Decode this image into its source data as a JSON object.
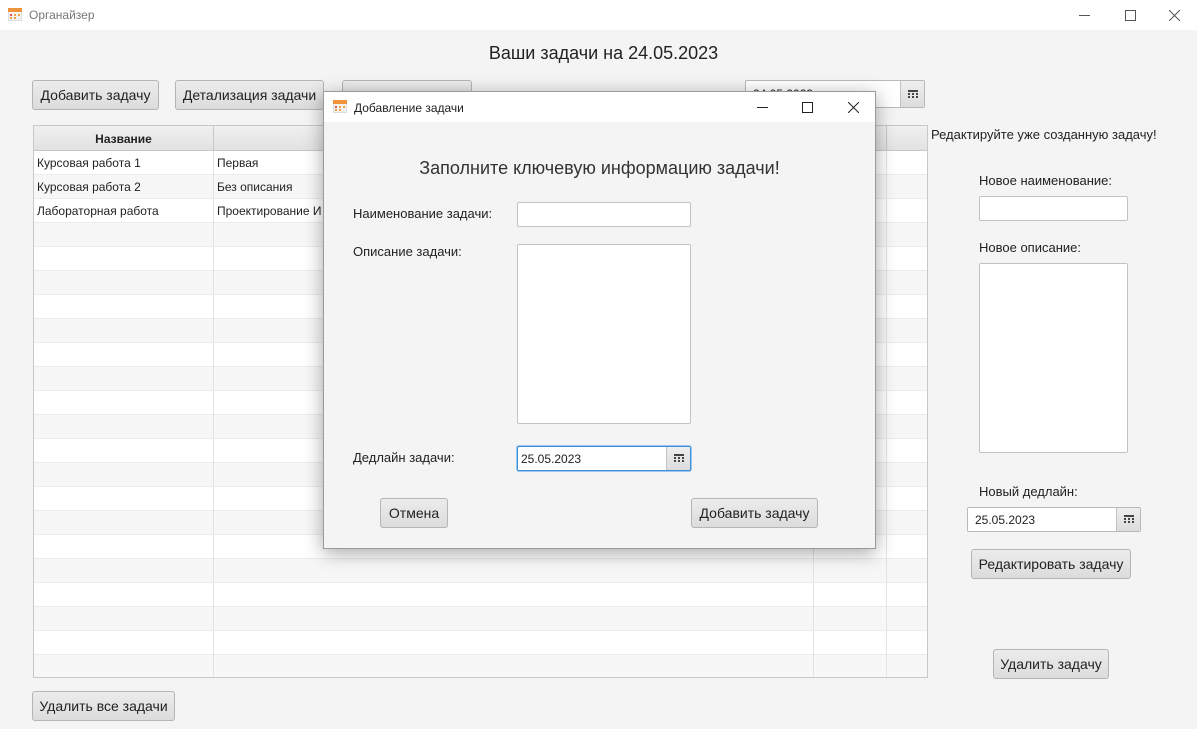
{
  "window": {
    "title": "Органайзер",
    "icon": "calendar-icon"
  },
  "page_title": "Ваши задачи на 24.05.2023",
  "toolbar": {
    "add_label": "Добавить задачу",
    "details_label": "Детализация задачи",
    "date_value": "24.05.2023"
  },
  "table": {
    "columns": [
      "Название",
      "",
      "",
      ""
    ],
    "rows": [
      [
        "Курсовая работа 1",
        "Первая"
      ],
      [
        "Курсовая работа 2",
        "Без описания"
      ],
      [
        "Лабораторная работа",
        "Проектирование И"
      ]
    ]
  },
  "right_panel": {
    "heading": "Редактируйте уже созданную задачу!",
    "name_label": "Новое наименование:",
    "name_value": "",
    "desc_label": "Новое описание:",
    "desc_value": "",
    "deadline_label": "Новый дедлайн:",
    "deadline_value": "25.05.2023",
    "edit_button": "Редактировать задачу",
    "delete_button": "Удалить задачу"
  },
  "bottom": {
    "delete_all_button": "Удалить все задачи"
  },
  "dialog": {
    "title": "Добавление задачи",
    "heading": "Заполните ключевую информацию задачи!",
    "name_label": "Наименование задачи:",
    "name_value": "",
    "desc_label": "Описание задачи:",
    "desc_value": "",
    "deadline_label": "Дедлайн задачи:",
    "deadline_value": "25.05.2023",
    "cancel_button": "Отмена",
    "add_button": "Добавить задачу"
  },
  "colors": {
    "focus": "#3c8fd8",
    "background": "#f4f4f4"
  }
}
